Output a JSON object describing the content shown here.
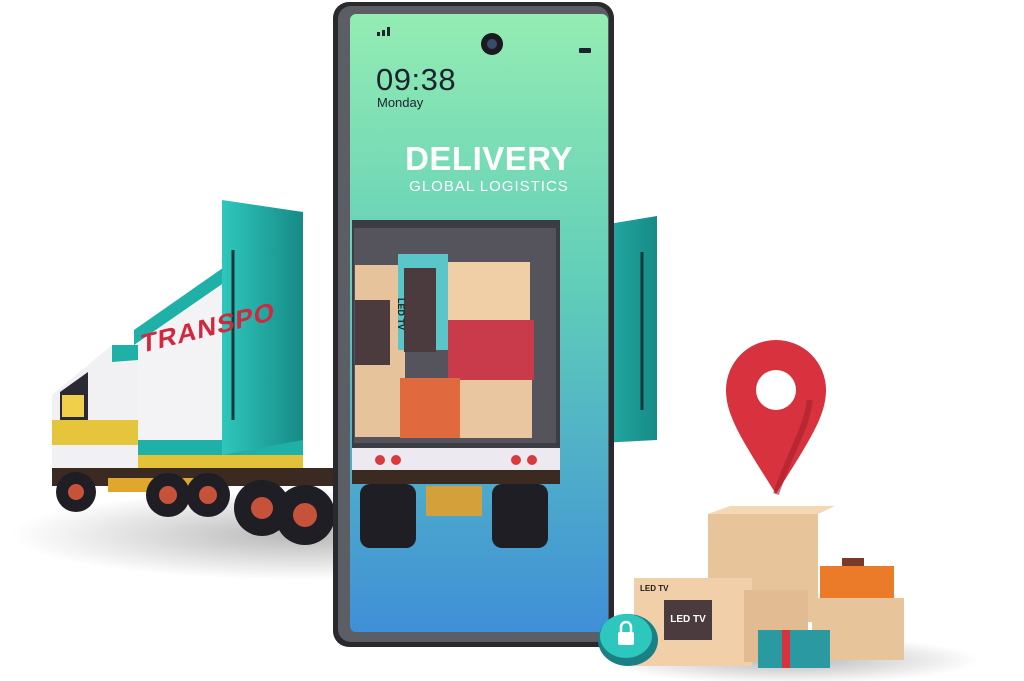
{
  "phone": {
    "time": "09:38",
    "day": "Monday",
    "title": "DELIVERY",
    "subtitle": "GLOBAL LOGISTICS"
  },
  "truck": {
    "side_text": "TRANSPO"
  },
  "cargo": {
    "box_label_tv": "LED TV",
    "box_label_tv_small": "LED TV",
    "box_label_in_truck": "LED TV"
  },
  "icons": [
    "signal-icon",
    "camera-icon",
    "battery-icon",
    "map-pin-icon",
    "padlock-icon"
  ],
  "colors": {
    "screen_top": "#8fe6b5",
    "screen_bottom": "#3f8fd8",
    "teal": "#1fb1a8",
    "pin_red": "#d8323f",
    "cardboard": "#e8c49b",
    "orange_box": "#ec7b29"
  }
}
